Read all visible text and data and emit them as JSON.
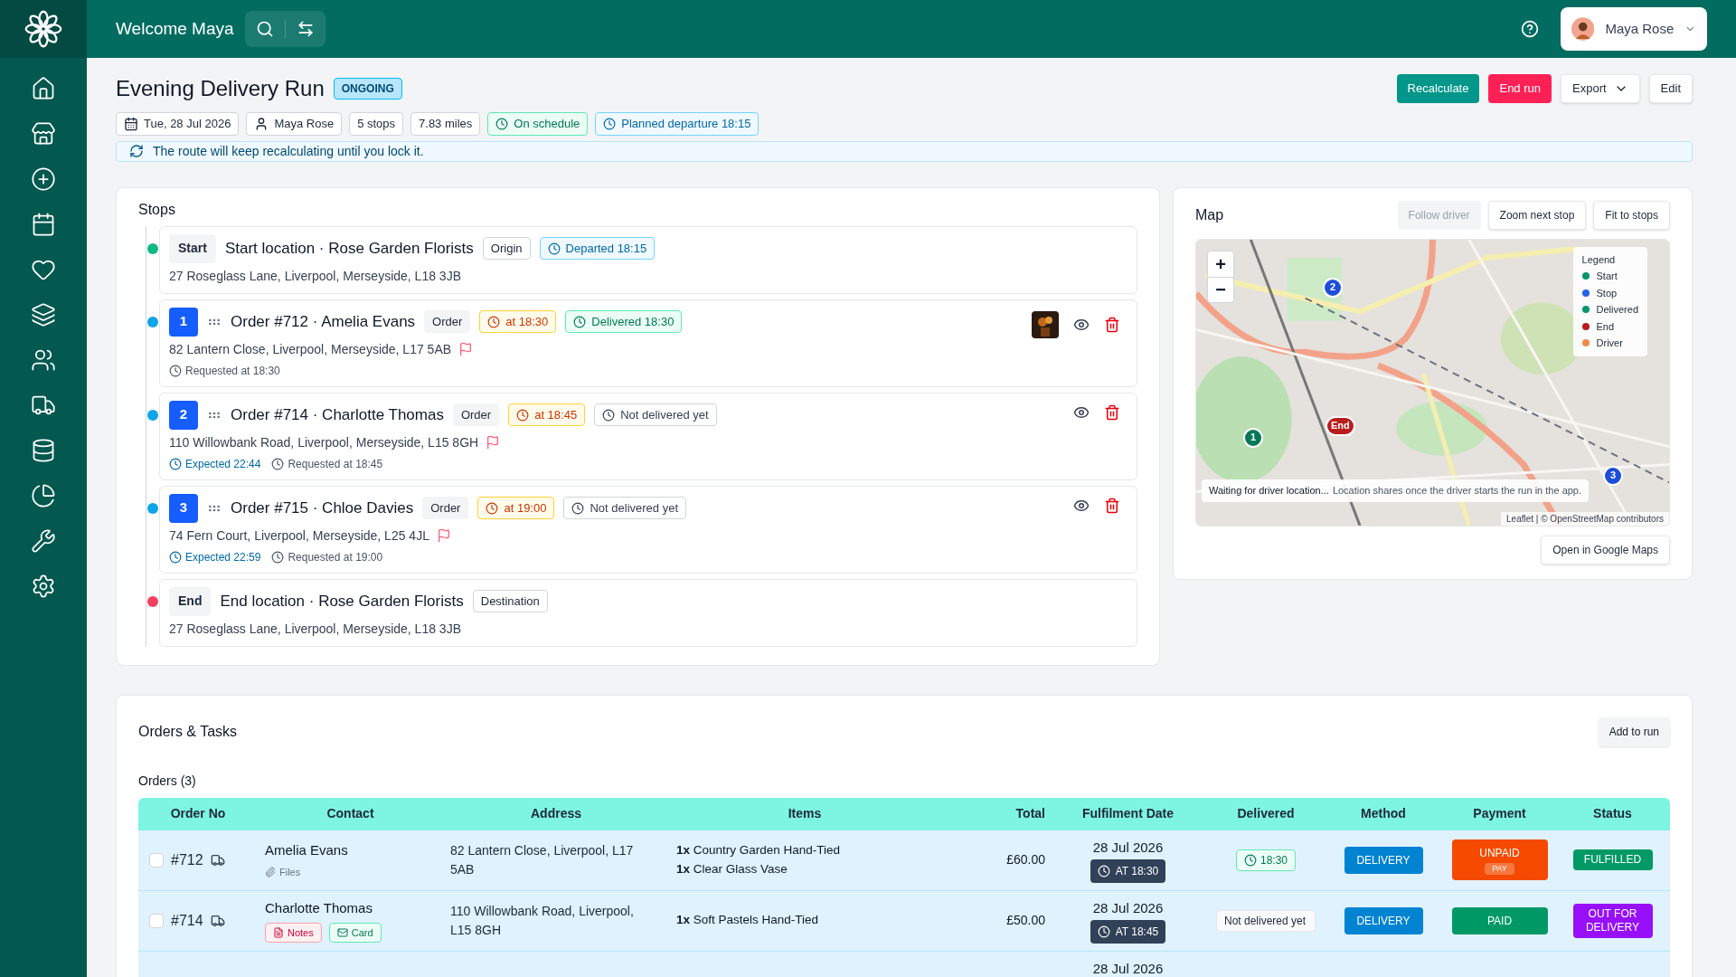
{
  "header": {
    "greeting": "Welcome Maya",
    "user": {
      "name": "Maya Rose"
    }
  },
  "run": {
    "title": "Evening Delivery Run",
    "status": "ONGOING",
    "meta": [
      {
        "kind": "date",
        "text": "Tue, 28 Jul 2026"
      },
      {
        "kind": "person",
        "text": "Maya Rose"
      },
      {
        "kind": "plain",
        "text": "5 stops"
      },
      {
        "kind": "plain",
        "text": "7.83 miles"
      },
      {
        "kind": "success",
        "text": "On schedule"
      },
      {
        "kind": "info",
        "text": "Planned departure 18:15"
      }
    ],
    "actions": [
      {
        "kind": "primary",
        "label": "Recalculate"
      },
      {
        "kind": "danger",
        "label": "End run"
      },
      {
        "kind": "menu",
        "label": "Export"
      },
      {
        "kind": "plain",
        "label": "Edit"
      }
    ],
    "notice": "The route will keep recalculating until you lock it."
  },
  "stops": {
    "title": "Stops",
    "items": [
      {
        "kind": "start",
        "color": "#10b981",
        "marker": "Start",
        "title": "Start location · Rose Garden Florists",
        "tags": [
          {
            "kind": "plain",
            "text": "Origin"
          },
          {
            "kind": "info",
            "text": "Departed 18:15"
          }
        ],
        "address": "27 Roseglass Lane, Liverpool, Merseyside, L18 3JB"
      },
      {
        "kind": "order",
        "color": "#0ea5e9",
        "marker": "1",
        "title": "Order #712 · Amelia Evans",
        "tags": [
          {
            "kind": "gray",
            "text": "Order"
          },
          {
            "kind": "time",
            "text": "at 18:30"
          },
          {
            "kind": "success",
            "text": "Delivered 18:30"
          }
        ],
        "address": "82 Lantern Close, Liverpool, Merseyside, L17 5AB",
        "times": [
          {
            "kind": "requested",
            "text": "Requested at 18:30"
          }
        ],
        "photo": true
      },
      {
        "kind": "order",
        "color": "#0ea5e9",
        "marker": "2",
        "title": "Order #714 · Charlotte Thomas",
        "tags": [
          {
            "kind": "gray",
            "text": "Order"
          },
          {
            "kind": "time",
            "text": "at 18:45"
          },
          {
            "kind": "pending",
            "text": "Not delivered yet"
          }
        ],
        "address": "110 Willowbank Road, Liverpool, Merseyside, L15 8GH",
        "times": [
          {
            "kind": "expected",
            "text": "Expected 22:44"
          },
          {
            "kind": "requested",
            "text": "Requested at 18:45"
          }
        ],
        "photo": false
      },
      {
        "kind": "order",
        "color": "#0ea5e9",
        "marker": "3",
        "title": "Order #715 · Chloe Davies",
        "tags": [
          {
            "kind": "gray",
            "text": "Order"
          },
          {
            "kind": "time",
            "text": "at 19:00"
          },
          {
            "kind": "pending",
            "text": "Not delivered yet"
          }
        ],
        "address": "74 Fern Court, Liverpool, Merseyside, L25 4JL",
        "times": [
          {
            "kind": "expected",
            "text": "Expected 22:59"
          },
          {
            "kind": "requested",
            "text": "Requested at 19:00"
          }
        ],
        "photo": false
      },
      {
        "kind": "end",
        "color": "#f43f5e",
        "marker": "End",
        "title": "End location · Rose Garden Florists",
        "tags": [
          {
            "kind": "plain",
            "text": "Destination"
          }
        ],
        "address": "27 Roseglass Lane, Liverpool, Merseyside, L18 3JB"
      }
    ]
  },
  "map": {
    "title": "Map",
    "buttons": [
      {
        "label": "Follow driver",
        "disabled": true
      },
      {
        "label": "Zoom next stop",
        "disabled": false
      },
      {
        "label": "Fit to stops",
        "disabled": false
      }
    ],
    "zoom_in": "+",
    "zoom_out": "−",
    "legend": {
      "title": "Legend",
      "items": [
        {
          "label": "Start",
          "color": "#059669"
        },
        {
          "label": "Stop",
          "color": "#2563eb"
        },
        {
          "label": "Delivered",
          "color": "#059669"
        },
        {
          "label": "End",
          "color": "#b91c1c"
        },
        {
          "label": "Driver",
          "color": "#f08a4b"
        }
      ]
    },
    "markers": [
      {
        "label": "1",
        "color": "#047857"
      },
      {
        "label": "2",
        "color": "#1d4ed8"
      },
      {
        "label": "3",
        "color": "#1d4ed8"
      },
      {
        "label": "End",
        "color": "#b91c1c"
      }
    ],
    "notice": {
      "status": "Waiting for driver location...",
      "detail": "Location shares once the driver starts the run in the app."
    },
    "attribution": "Leaflet | © OpenStreetMap contributors",
    "open_button": "Open in Google Maps"
  },
  "orders": {
    "title": "Orders & Tasks",
    "add_button": "Add to run",
    "subtitle": "Orders (3)",
    "columns": [
      "Order No",
      "Contact",
      "Address",
      "Items",
      "Total",
      "Fulfilment Date",
      "Delivered",
      "Method",
      "Payment",
      "Status"
    ],
    "rows": [
      {
        "checked": false,
        "number": "#712",
        "contact": "Amelia Evans",
        "attachments": [
          {
            "kind": "files",
            "text": "Files"
          }
        ],
        "address": "82 Lantern Close, Liverpool, L17 5AB",
        "items": [
          {
            "qty": "1x",
            "name": "Country Garden Hand-Tied"
          },
          {
            "qty": "1x",
            "name": "Clear Glass Vase"
          }
        ],
        "total": "£60.00",
        "date": "28 Jul 2026",
        "time": "AT 18:30",
        "delivered": {
          "kind": "done",
          "text": "18:30"
        },
        "method": "DELIVERY",
        "payment": {
          "kind": "unpaid",
          "text": "UNPAID",
          "action": "PAY"
        },
        "status": {
          "kind": "fulfilled",
          "text": "FULFILLED"
        }
      },
      {
        "checked": false,
        "number": "#714",
        "contact": "Charlotte Thomas",
        "attachments": [
          {
            "kind": "notes",
            "text": "Notes"
          },
          {
            "kind": "card",
            "text": "Card"
          }
        ],
        "address": "110 Willowbank Road, Liverpool, L15 8GH",
        "items": [
          {
            "qty": "1x",
            "name": "Soft Pastels Hand-Tied"
          }
        ],
        "total": "£50.00",
        "date": "28 Jul 2026",
        "time": "AT 18:45",
        "delivered": {
          "kind": "pending",
          "text": "Not delivered yet"
        },
        "method": "DELIVERY",
        "payment": {
          "kind": "paid",
          "text": "PAID"
        },
        "status": {
          "kind": "out",
          "text": "OUT FOR DELIVERY"
        }
      },
      {
        "date": "28 Jul 2026"
      }
    ]
  }
}
